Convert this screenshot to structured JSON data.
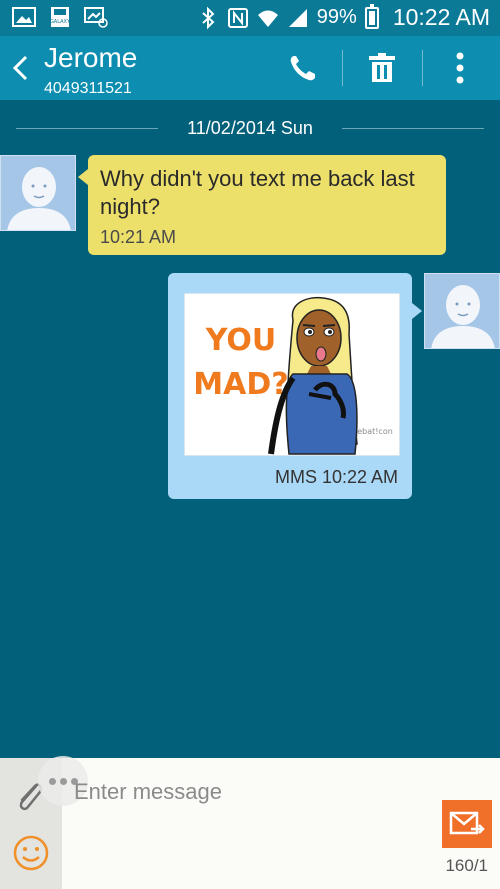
{
  "status_bar": {
    "battery": "99%",
    "time": "10:22 AM"
  },
  "action_bar": {
    "contact_name": "Jerome",
    "contact_number": "4049311521"
  },
  "conversation": {
    "date_header": "11/02/2014 Sun",
    "messages": [
      {
        "direction": "incoming",
        "text": "Why didn't you text me back last night?",
        "time": "10:21 AM"
      },
      {
        "direction": "outgoing",
        "type": "MMS",
        "image_text_line1": "YOU",
        "image_text_line2": "MAD?",
        "image_watermark": "ebat!con",
        "time": "MMS 10:22 AM"
      }
    ]
  },
  "composer": {
    "placeholder": "Enter message",
    "char_counter": "160/1"
  },
  "colors": {
    "status_bar": "#0b7a97",
    "action_bar": "#0d8eb0",
    "background": "#03607a",
    "incoming_bubble": "#ecdf6a",
    "outgoing_bubble": "#aad9f8",
    "send_button": "#f0702a"
  }
}
